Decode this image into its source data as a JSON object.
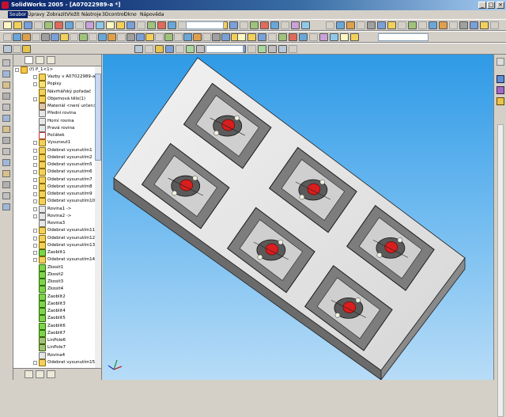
{
  "window": {
    "title": "SolidWorks 2005 - [A07022989-a *]"
  },
  "menu": [
    "Soubor",
    "Úpravy",
    "Zobrazit",
    "Vložit",
    "Nástroje",
    "3Dcontrol",
    "Okno",
    "Nápověda"
  ],
  "menu_active": "Soubor",
  "tree": {
    "root": "(f) P_1<1>",
    "items": [
      "Vazby v A07022989-a",
      "Popisy",
      "Návrhářský pořadač",
      "Objemová tělo(1)",
      "Materiál <není určen>",
      "Přední rovina",
      "Horní rovina",
      "Pravá rovina",
      "Počátek",
      "Vysunout1",
      "Odebrat vysunutím1",
      "Odebrat vysunutím2",
      "Odebrat vysunutím5",
      "Odebrat vysunutím6",
      "Odebrat vysunutím7",
      "Odebrat vysunutím8",
      "Odebrat vysunutím9",
      "Odebrat vysunutím10",
      "Rovina1 ->",
      "Rovina2 ->",
      "Rovina3",
      "Odebrat vysunutím11",
      "Odebrat vysunutím12",
      "Odebrat vysunutím13",
      "Zaoblit1",
      "Odebrat vysunutím14",
      "Zkosit1",
      "Zkosit2",
      "Zkosit3",
      "Zkosit4",
      "Zaoblit2",
      "Zaoblit3",
      "Zaoblit4",
      "Zaoblit5",
      "Zaoblit6",
      "Zaoblit7",
      "LinPole6",
      "LinPole7",
      "Rovina4",
      "Odebrat vysunutím15"
    ]
  },
  "colors": {
    "accent": "#0a246a",
    "viewport_top": "#2f9ae6",
    "viewport_bottom": "#b7dcf7",
    "part_red": "#d81e1e"
  },
  "icons": {
    "window_buttons": [
      "minimize-icon",
      "maximize-icon",
      "close-icon"
    ],
    "triad": "axis-triad-icon"
  }
}
